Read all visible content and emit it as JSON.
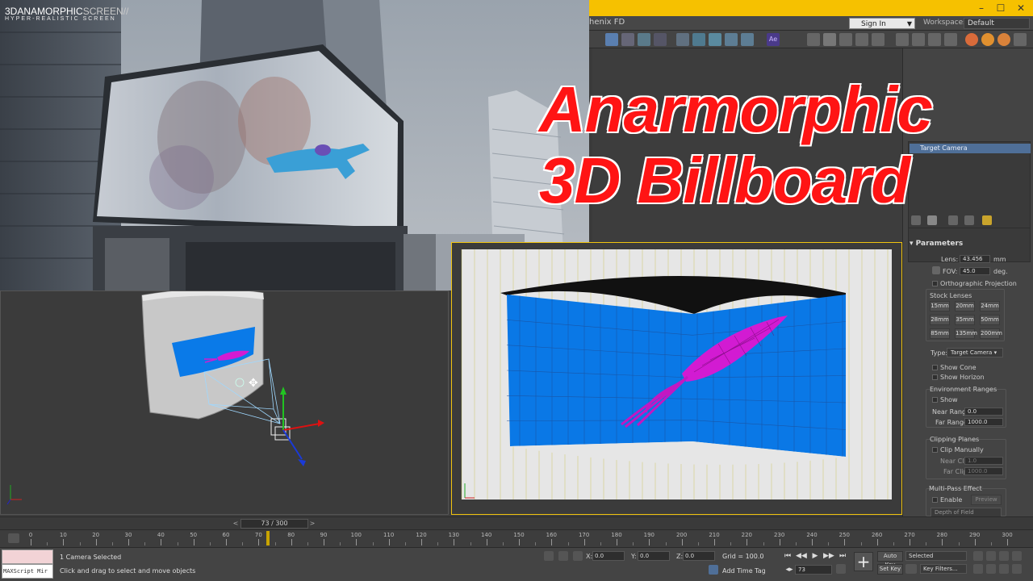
{
  "photo": {
    "watermark_main": "3DANAMORPHIC",
    "watermark_light": "SCREEN//",
    "watermark_sub": "HYPER-REALISTIC SCREEN"
  },
  "headline": {
    "line1": "Anarmorphic",
    "line2": "3D Billboard"
  },
  "titlebar": {
    "minimize": "–",
    "maximize": "☐",
    "close": "✕"
  },
  "menubar": {
    "app_label": "henix FD",
    "signin": "Sign In",
    "workspaces_label": "Workspaces:",
    "workspace_value": "Default"
  },
  "command_panel": {
    "object_list_item": "Target Camera",
    "rollout_title": "Parameters",
    "lens_label": "Lens:",
    "lens_value": "43.456",
    "lens_unit": "mm",
    "fov_label": "FOV:",
    "fov_value": "45.0",
    "fov_unit": "deg.",
    "ortho_label": "Orthographic Projection",
    "stock_lenses_label": "Stock Lenses",
    "stock_lenses": [
      "15mm",
      "20mm",
      "24mm",
      "28mm",
      "35mm",
      "50mm",
      "85mm",
      "135mm",
      "200mm"
    ],
    "type_label": "Type:",
    "type_value": "Target Camera",
    "show_cone": "Show Cone",
    "show_horizon": "Show Horizon",
    "env_ranges_label": "Environment Ranges",
    "env_show": "Show",
    "near_range_label": "Near Range:",
    "near_range_value": "0.0",
    "far_range_label": "Far Range:",
    "far_range_value": "1000.0",
    "clipping_label": "Clipping Planes",
    "clip_manually": "Clip Manually",
    "near_clip_label": "Near Clip:",
    "near_clip_value": "1.0",
    "far_clip_label": "Far Clip:",
    "far_clip_value": "1000.0",
    "multipass_label": "Multi-Pass Effect",
    "enable_label": "Enable",
    "preview_label": "Preview",
    "depth_of_field": "Depth of Field"
  },
  "timeline": {
    "frame_display": "73 / 300",
    "current_frame": 73,
    "total_frames": 300,
    "ticks": [
      0,
      10,
      20,
      30,
      40,
      50,
      60,
      70,
      80,
      90,
      100,
      110,
      120,
      130,
      140,
      150,
      160,
      170,
      180,
      190,
      200,
      210,
      220,
      230,
      240,
      250,
      260,
      270,
      280,
      290,
      300
    ]
  },
  "status": {
    "maxscript_label": "MAXScript Mir",
    "selection_text": "1 Camera Selected",
    "prompt_text": "Click and drag to select and move objects",
    "x_label": "X:",
    "x_value": "0.0",
    "y_label": "Y:",
    "y_value": "0.0",
    "z_label": "Z:",
    "z_value": "0.0",
    "grid_text": "Grid = 100.0",
    "add_time_tag": "Add Time Tag",
    "frame_value": "73",
    "auto_key": "Auto Key",
    "set_key": "Set Key",
    "selected_value": "Selected",
    "key_filters": "Key Filters..."
  },
  "colors": {
    "accent_yellow": "#f6c100",
    "headline_red": "#ff1414",
    "billboard_blue": "#0a78e6",
    "squid_magenta": "#d21bd2"
  }
}
